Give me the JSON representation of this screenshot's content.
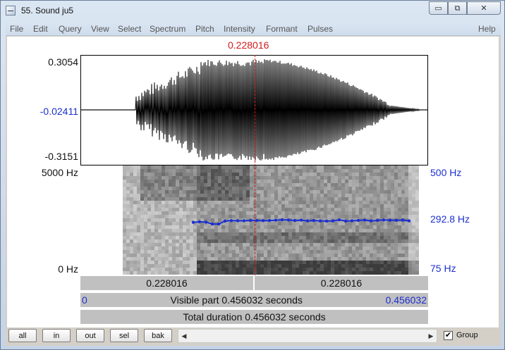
{
  "window": {
    "title": "55. Sound ju5",
    "controls": {
      "minimize": "▭",
      "maximize": "⧉",
      "close": "✕"
    }
  },
  "menu": [
    "File",
    "Edit",
    "Query",
    "View",
    "Select",
    "Spectrum",
    "Pitch",
    "Intensity",
    "Formant",
    "Pulses",
    "Help"
  ],
  "editor": {
    "cursor_time": "0.228016",
    "waveform": {
      "max_label": "0.3054",
      "mid_label": "-0.02411",
      "min_label": "-0.3151"
    },
    "spectrogram": {
      "max_freq_label": "5000 Hz",
      "min_freq_label": "0 Hz",
      "pitch_max_label": "500 Hz",
      "pitch_cursor_label": "292.8 Hz",
      "pitch_min_label": "75 Hz"
    },
    "bars": {
      "left_time": "0.228016",
      "right_time": "0.228016",
      "visible_start": "0",
      "visible_label": "Visible part 0.456032 seconds",
      "visible_end": "0.456032",
      "total_label": "Total duration 0.456032 seconds"
    }
  },
  "bottom": {
    "buttons": [
      "all",
      "in",
      "out",
      "sel",
      "bak"
    ],
    "scroll_left": "◀",
    "scroll_right": "▶",
    "group_checked": "✔",
    "group_label": "Group"
  },
  "colors": {
    "cursor": "#d11a1a",
    "pitch": "#1c2fd0"
  }
}
